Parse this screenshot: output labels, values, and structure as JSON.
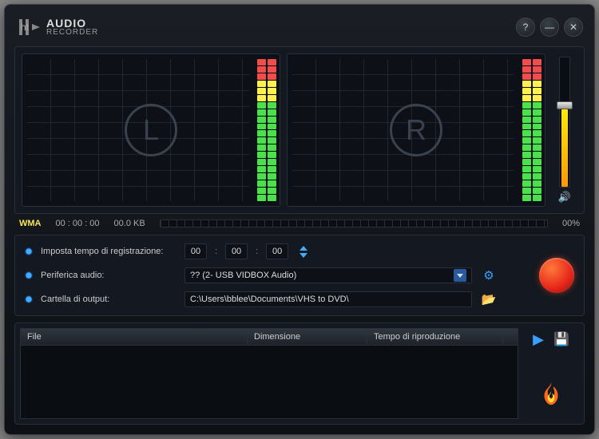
{
  "app": {
    "title": "AUDIO",
    "subtitle": "RECORDER"
  },
  "channels": {
    "left": "L",
    "right": "R"
  },
  "status": {
    "format": "WMA",
    "time": "00 : 00 : 00",
    "size": "00.0 KB",
    "progress": "00%"
  },
  "settings": {
    "rec_time_label": "Imposta tempo di registrazione:",
    "rec_time": {
      "h": "00",
      "m": "00",
      "s": "00"
    },
    "device_label": "Periferica audio:",
    "device_value": "?? (2- USB VIDBOX Audio)",
    "output_label": "Cartella di output:",
    "output_value": "C:\\Users\\bblee\\Documents\\VHS to DVD\\"
  },
  "table": {
    "cols": {
      "file": "File",
      "size": "Dimensione",
      "dur": "Tempo di riproduzione"
    }
  },
  "icons": {
    "help": "?",
    "min": "—",
    "close": "✕",
    "gear": "⚙",
    "folder": "📂",
    "play": "▶",
    "save": "💾",
    "speaker": "🔊"
  }
}
